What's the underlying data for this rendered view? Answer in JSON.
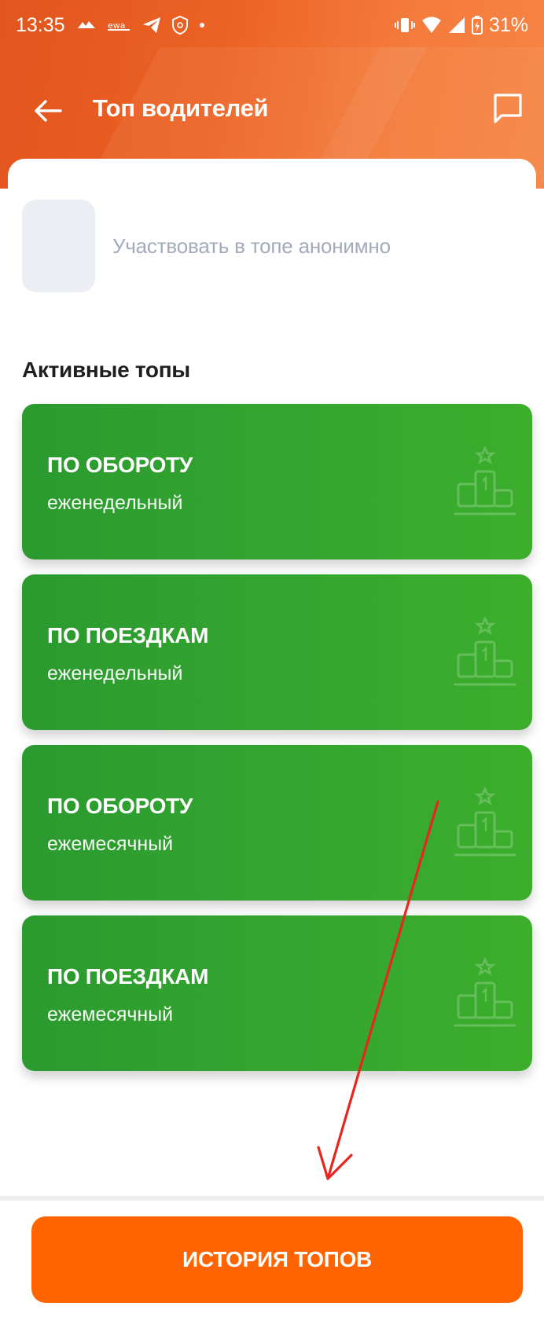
{
  "status_bar": {
    "time": "13:35",
    "battery": "31%",
    "left_icons": [
      "taxi-icon",
      "ewa-icon",
      "telegram-icon",
      "shield-icon",
      "dot-icon"
    ],
    "right_icons": [
      "vibrate-icon",
      "wifi-icon",
      "signal-icon",
      "battery-icon"
    ]
  },
  "header": {
    "title": "Топ водителей",
    "back_icon": "arrow-left-icon",
    "chat_icon": "chat-bubble-icon"
  },
  "anonymous": {
    "label": "Участвовать в топе анонимно",
    "checked": false
  },
  "active_tops": {
    "heading": "Активные топы",
    "items": [
      {
        "title": "ПО ОБОРОТУ",
        "period": "еженедельный",
        "icon": "podium-icon"
      },
      {
        "title": "ПО ПОЕЗДКАМ",
        "period": "еженедельный",
        "icon": "podium-icon"
      },
      {
        "title": "ПО ОБОРОТУ",
        "period": "ежемесячный",
        "icon": "podium-icon"
      },
      {
        "title": "ПО ПОЕЗДКАМ",
        "period": "ежемесячный",
        "icon": "podium-icon"
      }
    ]
  },
  "footer": {
    "history_button": "ИСТОРИЯ ТОПОВ"
  },
  "colors": {
    "header": "#ec6224",
    "card_green": "#34a62f",
    "button_orange": "#ff6400",
    "annotation_red": "#e8251f"
  }
}
